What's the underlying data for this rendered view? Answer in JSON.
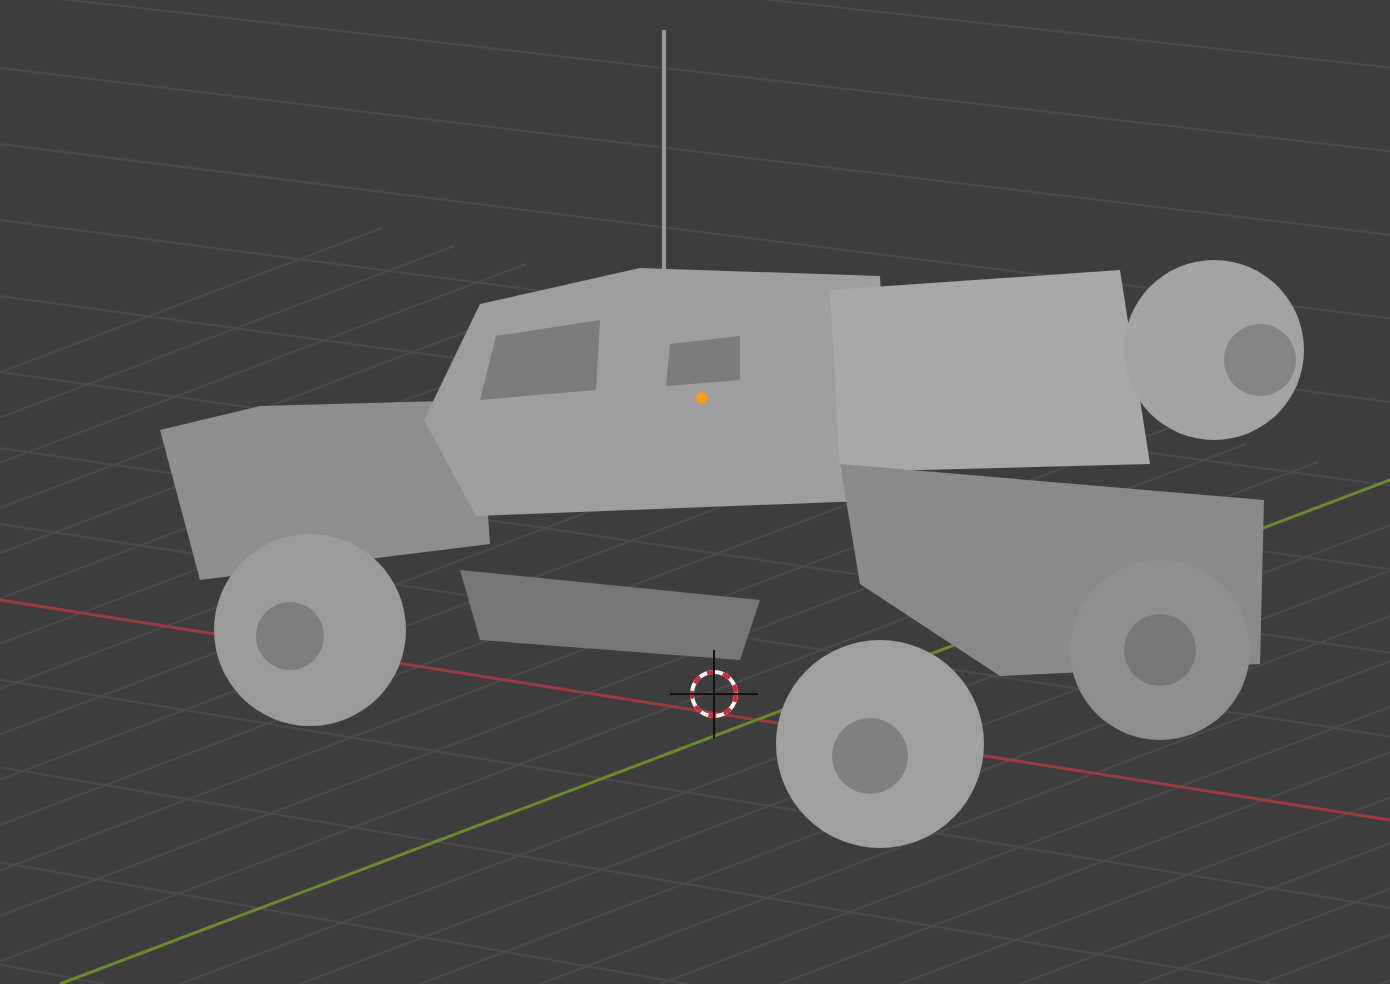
{
  "viewport": {
    "axes": [
      {
        "kind": "x",
        "color": "#9c3a44"
      },
      {
        "kind": "y",
        "color": "#6a8a2c"
      }
    ]
  }
}
